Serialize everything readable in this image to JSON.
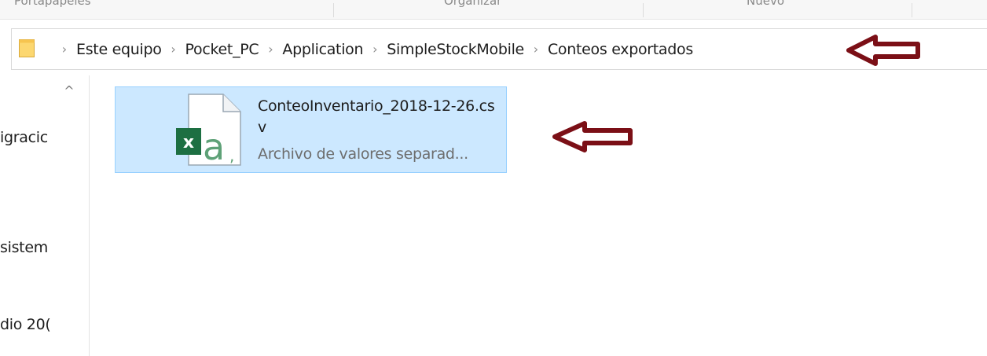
{
  "ribbon": {
    "groups": [
      "Portapapeles",
      "Organizar",
      "Nuevo"
    ]
  },
  "address": {
    "crumbs": [
      "Este equipo",
      "Pocket_PC",
      "Application",
      "SimpleStockMobile",
      "Conteos exportados"
    ]
  },
  "nav": {
    "items": [
      "igracic",
      "sistem",
      "dio 20("
    ]
  },
  "file": {
    "name": "ConteoInventario_2018-12-26.csv",
    "type": "Archivo de valores separad..."
  },
  "colors": {
    "selection_bg": "#cce8ff",
    "selection_border": "#99d1ff",
    "arrow": "#7b0f16",
    "excel_green": "#1d6f42"
  },
  "icons": {
    "folder": "folder-icon",
    "chevron": "chevron-right-icon",
    "file": "csv-file-icon",
    "annotation": "arrow-left-icon"
  }
}
